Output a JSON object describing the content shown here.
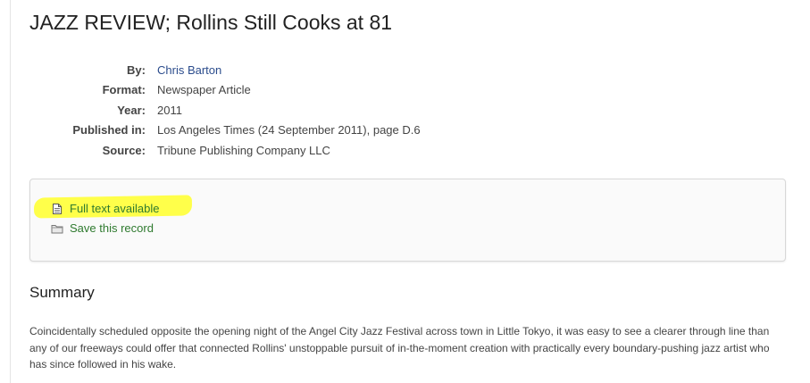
{
  "record": {
    "title": "JAZZ REVIEW; Rollins Still Cooks at 81"
  },
  "metadata": [
    {
      "label": "By:",
      "value": "Chris Barton",
      "link": true
    },
    {
      "label": "Format:",
      "value": "Newspaper Article",
      "link": false
    },
    {
      "label": "Year:",
      "value": "2011",
      "link": false
    },
    {
      "label": "Published in:",
      "value": "Los Angeles Times (24 September 2011), page D.6",
      "link": false
    },
    {
      "label": "Source:",
      "value": "Tribune Publishing Company LLC",
      "link": false
    }
  ],
  "actions": {
    "full_text": {
      "label": "Full text available",
      "icon": "document-icon"
    },
    "save": {
      "label": "Save this record",
      "icon": "folder-icon"
    }
  },
  "summary": {
    "heading": "Summary",
    "text": "Coincidentally scheduled opposite the opening night of the Angel City Jazz Festival across town in Little Tokyo, it was easy to see a clearer through line than any of our freeways could offer that connected Rollins' unstoppable pursuit of in-the-moment creation with practically every boundary-pushing jazz artist who has since followed in his wake."
  },
  "colors": {
    "link": "#2b4c8c",
    "action_text": "#2f7a2f",
    "highlight": "#ffff4a"
  }
}
